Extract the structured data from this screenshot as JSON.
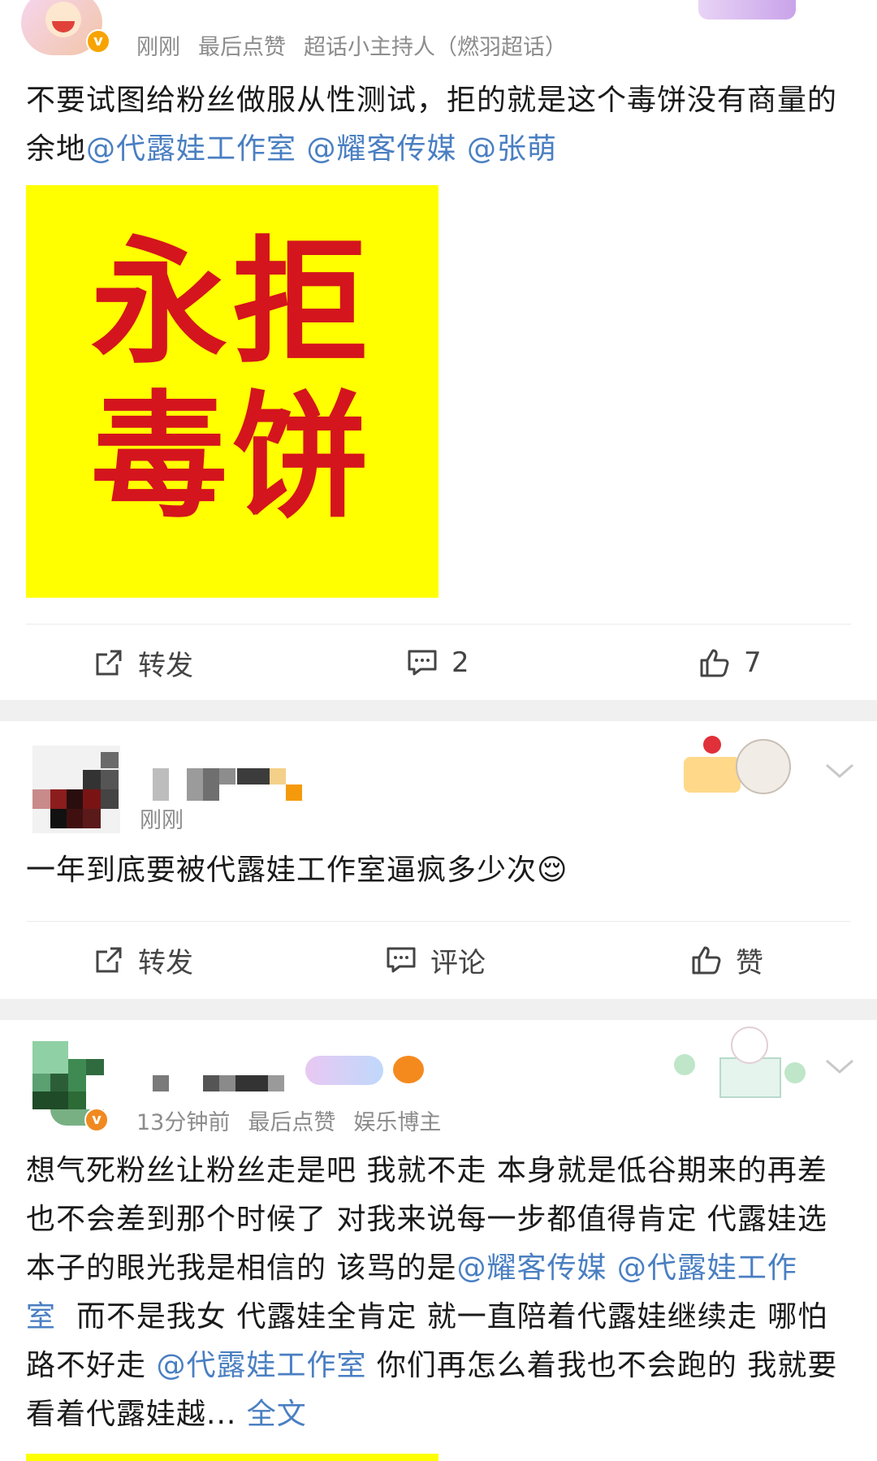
{
  "posts": [
    {
      "meta": {
        "time": "刚刚",
        "liked": "最后点赞",
        "role": "超话小主持人（燃羽超话）"
      },
      "text_plain": "不要试图给粉丝做服从性测试，拒的就是这个毒饼没有商量的余地",
      "mentions": [
        "@代露娃工作室",
        "@耀客传媒",
        "@张萌"
      ],
      "image_lines": [
        "永拒",
        "毒饼"
      ],
      "actions": {
        "repost": "转发",
        "comment": "2",
        "like": "7"
      }
    },
    {
      "meta": {
        "time": "刚刚"
      },
      "text_plain": "一年到底要被代露娃工作室逼疯多少次",
      "emoji": "😌",
      "actions": {
        "repost": "转发",
        "comment": "评论",
        "like": "赞"
      }
    },
    {
      "meta": {
        "time": "13分钟前",
        "liked": "最后点赞",
        "role": "娱乐博主"
      },
      "seg1": "想气死粉丝让粉丝走是吧 我就不走 本身就是低谷期来的再差也不会差到那个时候了 对我来说每一步都值得肯定 代露娃选本子的眼光我是相信的 该骂的是",
      "m1": "@耀客传媒",
      "m2": "@代露娃工作室",
      "seg2": "而不是我女 代露娃全肯定 就一直陪着代露娃继续走 哪怕路不好走 ",
      "m3": "@代露娃工作室",
      "seg3": "你们再怎么着我也不会跑的 我就要看着代露娃越...",
      "more": "全文"
    }
  ],
  "colors": {
    "link": "#4a7fc2",
    "poster_bg": "#ffff00",
    "poster_text": "#d4151d",
    "badge": "#f7a400",
    "separator": "#f0f0f0"
  }
}
